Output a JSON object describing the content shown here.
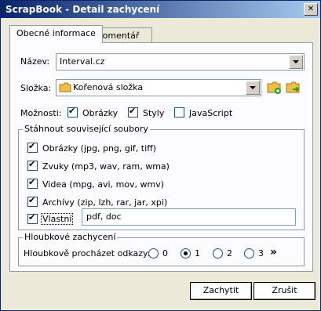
{
  "window": {
    "title": "ScrapBook - Detail zachycení",
    "close_glyph": "✕"
  },
  "tabs": [
    {
      "label": "Obecné informace",
      "active": true
    },
    {
      "label": "Komentář",
      "active": false
    }
  ],
  "form": {
    "name_label": "Název:",
    "name_value": "Interval.cz",
    "folder_label": "Složka:",
    "folder_value": "Kořenová složka",
    "options_label": "Možnosti:",
    "options": [
      {
        "label": "Obrázky",
        "checked": true
      },
      {
        "label": "Styly",
        "checked": true
      },
      {
        "label": "JavaScript",
        "checked": false
      }
    ]
  },
  "download_group": {
    "title": "Stáhnout související soubory",
    "items": [
      {
        "label": "Obrázky (jpg, png, gif, tiff)",
        "checked": true
      },
      {
        "label": "Zvuky (mp3, wav, ram, wma)",
        "checked": true
      },
      {
        "label": "Videa (mpg, avi, mov, wmv)",
        "checked": true
      },
      {
        "label": "Archívy (zip, lzh, rar, jar, xpi)",
        "checked": true
      }
    ],
    "custom": {
      "label": "Vlastní",
      "checked": true,
      "value": "pdf, doc"
    }
  },
  "depth_group": {
    "title": "Hloubkové zachycení",
    "label": "Hloubkově procházet odkazy:",
    "options": [
      "0",
      "1",
      "2",
      "3"
    ],
    "selected": "1",
    "more_glyph": "»"
  },
  "buttons": {
    "capture": "Zachytit",
    "cancel": "Zrušit"
  },
  "colors": {
    "folder_icon": "#f0c040",
    "add_icon": "#2e9e2e"
  }
}
